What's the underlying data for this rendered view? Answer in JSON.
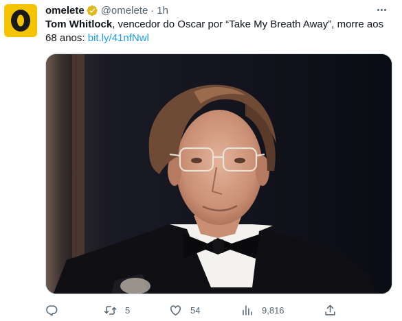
{
  "author": {
    "display_name": "omelete",
    "handle": "@omelete",
    "separator": "·",
    "time": "1h",
    "verified": true,
    "avatar_letter": "O"
  },
  "tweet": {
    "bold_text": "Tom Whitlock",
    "text": ", vencedor do Oscar por “Take My Breath Away”, morre aos 68 anos: ",
    "link": "bit.ly/41nfNwl"
  },
  "actions": {
    "replies": "",
    "retweets": "5",
    "likes": "54",
    "views": "9,816"
  },
  "icons": {
    "more": "more-icon",
    "reply": "reply-icon",
    "retweet": "retweet-icon",
    "like": "heart-icon",
    "views": "views-icon",
    "share": "share-icon"
  },
  "colors": {
    "link": "#1d9bf0",
    "verified_badge": "#e2b719",
    "avatar_bg": "#f5c400",
    "secondary_text": "#536471"
  }
}
